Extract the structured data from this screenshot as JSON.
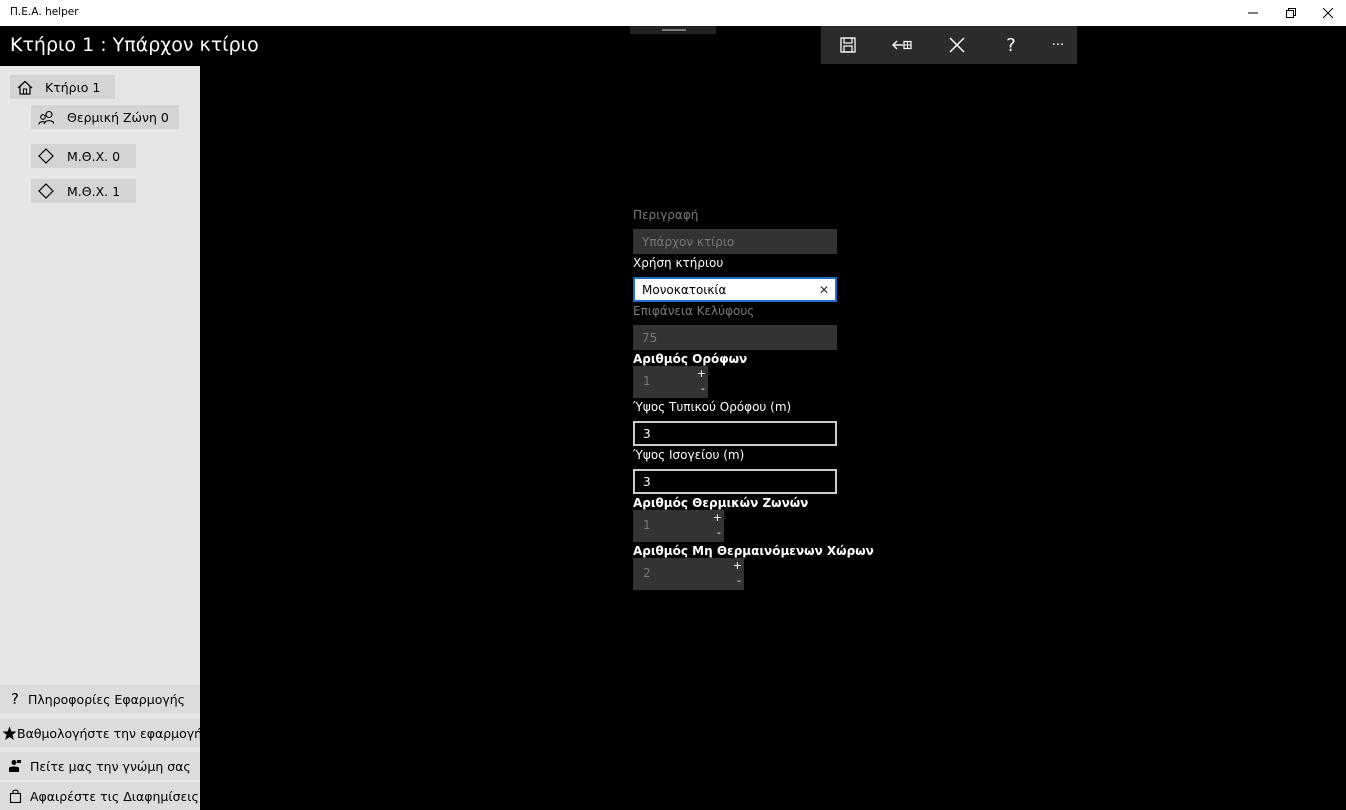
{
  "window": {
    "app_title": "Π.Ε.Α. helper"
  },
  "header": {
    "title": "Κτήριο 1 : Υπάρχον κτίριο"
  },
  "commands": {
    "save_icon": "save-icon",
    "back_icon": "back-arrow-icon",
    "close_icon": "close-icon",
    "help_label": "?",
    "more_label": "···"
  },
  "sidebar": {
    "tree": [
      {
        "label": "Κτήριο   1",
        "icon": "home-icon"
      },
      {
        "label": "Θερμική Ζώνη   0",
        "icon": "people-icon"
      },
      {
        "label": "Μ.Θ.Χ.   0",
        "icon": "diamond-icon"
      },
      {
        "label": "Μ.Θ.Χ.   1",
        "icon": "diamond-icon"
      }
    ],
    "bottom": [
      {
        "label": "Πληροφορίες Εφαρμογής",
        "icon": "question-icon"
      },
      {
        "label": "Βαθμολογήστε την εφαρμογή",
        "icon": "star-icon"
      },
      {
        "label": "Πείτε μας την γνώμη σας",
        "icon": "feedback-icon"
      },
      {
        "label": "Αφαιρέστε τις Διαφημίσεις",
        "icon": "bag-icon"
      }
    ]
  },
  "form": {
    "description": {
      "label": "Περιγραφή",
      "value": "Υπάρχον κτίριο"
    },
    "usage": {
      "label": "Χρήση κτήριου",
      "value": "Μονοκατοικία",
      "clear": "✕"
    },
    "shell_area": {
      "label": "Επιφάνεια Κελύφους",
      "value": "75"
    },
    "floors": {
      "label": "Αριθμός Ορόφων",
      "value": "1",
      "plus": "+",
      "minus": "-"
    },
    "typical_floor_height": {
      "label": "Ύψος Τυπικού Ορόφου (m)",
      "value": "3"
    },
    "ground_floor_height": {
      "label": "Ύψος Ισογείου (m)",
      "value": "3"
    },
    "thermal_zones": {
      "label": "Αριθμός Θερμικών Ζωνών",
      "value": "1",
      "plus": "+",
      "minus": "-"
    },
    "unheated_spaces": {
      "label": "Αριθμός Μη Θερμαινόμενων Χώρων",
      "value": "2",
      "plus": "+",
      "minus": "-"
    }
  },
  "colors": {
    "background": "#000000",
    "sidebar": "#e6e6e6",
    "accent": "#1e6ec8",
    "disabled_field": "#333333"
  }
}
